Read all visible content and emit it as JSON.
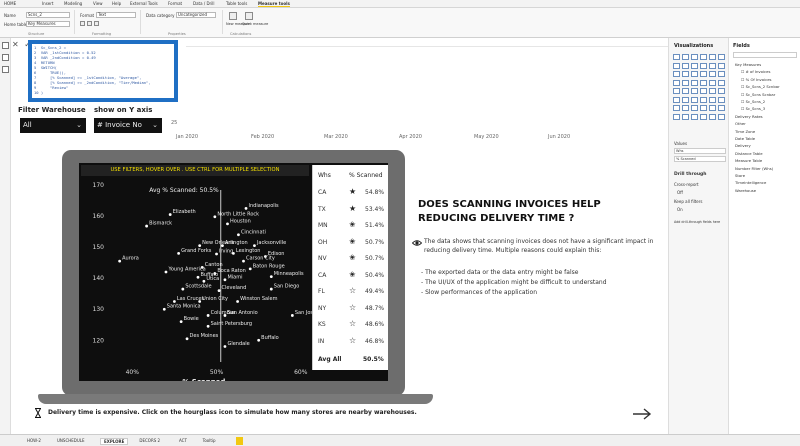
{
  "ribbon": {
    "tabs": [
      "HOME",
      "Insert",
      "Modeling",
      "View",
      "Help",
      "External Tools",
      "Format",
      "Data / Drill",
      "Table tools",
      "Measure tools"
    ],
    "active_tab": "Measure tools",
    "name_label": "Name",
    "name_value": "Scns_2",
    "home_table_label": "Home table",
    "home_table_value": "Key Measures",
    "format_label": "Format",
    "format_value": "Text",
    "data_category_label": "Data category",
    "data_category_value": "Uncategorized",
    "new_measure_label": "New measure",
    "quick_measure_label": "Quick measure",
    "groups": [
      "Structure",
      "Formatting",
      "Properties",
      "Calculations"
    ]
  },
  "code": {
    "lines": [
      "1  Sc_Scns_2 =",
      "2  VAR _1stCondition = 0.52",
      "3  VAR _2ndCondition = 0.49",
      "4  RETURN",
      "5  SWITCH(",
      "6      TRUE(),",
      "7      [% Scanned] >= _1stCondition, \"Average\",",
      "8      [% Scanned] >= _2ndCondition, \"Tier/Median\",",
      "9      \"Review\"",
      "10 )"
    ]
  },
  "line_chart": {
    "y_tick": "25",
    "x_ticks": [
      "Jan 2020",
      "Feb 2020",
      "Mar 2020",
      "Apr 2020",
      "May 2020",
      "Jun 2020"
    ]
  },
  "filters": {
    "filter_label": "Filter Warehouse",
    "filter_value": "All",
    "axis_label": "show on Y axis",
    "axis_value": "# Invoice No"
  },
  "scatter": {
    "banner": "USE FILTERS, HOVER OVER . USE CTRL FOR MULTIPLE SELECTION",
    "avg_label": "Avg % Scanned: 50.5%",
    "x_label": "% Scanned"
  },
  "chart_data": {
    "type": "scatter",
    "xlabel": "% Scanned",
    "x_ticks": [
      "40%",
      "50%",
      "60%"
    ],
    "y_ticks": [
      "170",
      "160",
      "150",
      "140",
      "130",
      "120"
    ],
    "xlim": [
      37,
      60.5
    ],
    "ylim": [
      113,
      171
    ],
    "avg_x": 50.5,
    "points": [
      {
        "label": "Indianapolis",
        "x": 53.5,
        "y": 162.5
      },
      {
        "label": "Elizabeth",
        "x": 44.5,
        "y": 160.5
      },
      {
        "label": "North Little Rock",
        "x": 49.8,
        "y": 159.8
      },
      {
        "label": "Bismarck",
        "x": 41.7,
        "y": 156.8
      },
      {
        "label": "Houston",
        "x": 51.3,
        "y": 157.5
      },
      {
        "label": "Cincinnati",
        "x": 52.6,
        "y": 154.0
      },
      {
        "label": "New Orleans",
        "x": 48.0,
        "y": 150.5
      },
      {
        "label": "Arlington",
        "x": 50.7,
        "y": 150.5
      },
      {
        "label": "Jacksonville",
        "x": 54.5,
        "y": 150.5
      },
      {
        "label": "Grand Forks",
        "x": 45.5,
        "y": 148.0
      },
      {
        "label": "Irving",
        "x": 50.0,
        "y": 147.8
      },
      {
        "label": "Lexington",
        "x": 52.0,
        "y": 148.0
      },
      {
        "label": "Edison",
        "x": 55.8,
        "y": 147.0
      },
      {
        "label": "Aurora",
        "x": 38.5,
        "y": 145.5
      },
      {
        "label": "Canton",
        "x": 48.3,
        "y": 143.5
      },
      {
        "label": "Carson City",
        "x": 53.2,
        "y": 145.5
      },
      {
        "label": "Young America",
        "x": 44.0,
        "y": 142.0
      },
      {
        "label": "Boca Raton",
        "x": 49.8,
        "y": 141.5
      },
      {
        "label": "Baton Rouge",
        "x": 54.0,
        "y": 143.0
      },
      {
        "label": "Minneapolis",
        "x": 56.5,
        "y": 140.5
      },
      {
        "label": "Buffalo",
        "x": 47.8,
        "y": 140.3
      },
      {
        "label": "Utica",
        "x": 48.5,
        "y": 139.0
      },
      {
        "label": "Miami",
        "x": 51.0,
        "y": 139.5
      },
      {
        "label": "Scottsdale",
        "x": 46.0,
        "y": 136.5
      },
      {
        "label": "Cleveland",
        "x": 50.3,
        "y": 136.0
      },
      {
        "label": "San Diego",
        "x": 56.5,
        "y": 136.5
      },
      {
        "label": "Las Cruces",
        "x": 45.0,
        "y": 132.5
      },
      {
        "label": "Union City",
        "x": 48.0,
        "y": 132.5
      },
      {
        "label": "Winston Salem",
        "x": 52.5,
        "y": 132.5
      },
      {
        "label": "Santa Monica",
        "x": 43.8,
        "y": 130.0
      },
      {
        "label": "Columbus",
        "x": 49.0,
        "y": 128.0
      },
      {
        "label": "San Antonio",
        "x": 51.0,
        "y": 128.0
      },
      {
        "label": "San Jose",
        "x": 59.0,
        "y": 128.0
      },
      {
        "label": "Bowie",
        "x": 45.8,
        "y": 126.0
      },
      {
        "label": "Saint Petersburg",
        "x": 49.0,
        "y": 124.5
      },
      {
        "label": "Des Moines",
        "x": 46.5,
        "y": 120.5
      },
      {
        "label": "Buffalo",
        "x": 55.0,
        "y": 120.0
      },
      {
        "label": "Glendale",
        "x": 51.0,
        "y": 118.0
      }
    ]
  },
  "state_table": {
    "col_state": "Whs",
    "col_pct": "% Scanned",
    "rows": [
      {
        "state": "CA",
        "pct": "54.8%",
        "star": "★"
      },
      {
        "state": "TX",
        "pct": "53.4%",
        "star": "★"
      },
      {
        "state": "MN",
        "pct": "51.4%",
        "star": "✬"
      },
      {
        "state": "OH",
        "pct": "50.7%",
        "star": "✬"
      },
      {
        "state": "NV",
        "pct": "50.7%",
        "star": "✬"
      },
      {
        "state": "CA",
        "pct": "50.4%",
        "star": "✬"
      },
      {
        "state": "FL",
        "pct": "49.4%",
        "star": "☆"
      },
      {
        "state": "NY",
        "pct": "48.7%",
        "star": "☆"
      },
      {
        "state": "KS",
        "pct": "48.6%",
        "star": "☆"
      },
      {
        "state": "IN",
        "pct": "46.8%",
        "star": "☆"
      }
    ],
    "footer_label": "Avg All",
    "footer_value": "50.5%"
  },
  "insight": {
    "title": "DOES SCANNING INVOICES HELP REDUCING DELIVERY TIME ?",
    "body": "The data shows that scanning invoices does not have a significant impact in reducing delivery time. Multiple reasons could explain this:",
    "bullets": [
      "- The exported data or the data entry might be false",
      "- The UI/UX of the application might be difficult to understand",
      "- Slow performances of the application"
    ]
  },
  "bottom_note": "Delivery time is expensive. Click on the hourglass icon to simulate how many stores are nearby warehouses.",
  "visualizations": {
    "title": "Visualizations",
    "values_label": "Values",
    "values_fields": [
      "Whs",
      "% Scanned"
    ],
    "drill_title": "Drill through",
    "cross_report": "Cross-report",
    "off_label": "Off",
    "keep_filters": "Keep all filters",
    "on_label": "On",
    "add_drill": "Add drill-through fields here"
  },
  "fields": {
    "title": "Fields",
    "items": [
      "Key Measures",
      "# of Invoices",
      "% Of Invoices",
      "Sc_Scns_2 Scnbar",
      "Sc_Scns Scnbar",
      "Sc_Scns_2",
      "Sc_Scns_3",
      "Delivery Rates",
      "Other",
      "Time Zone",
      "Date Table",
      "Delivery",
      "Distance Table",
      "Measure Table",
      "Number Filter (Whs)",
      "Store",
      "Timeintelligence",
      "Warehouse"
    ]
  },
  "page_tabs": [
    "HOW-2",
    "UNSCHEDULE",
    "EXPLORE",
    "DECORS 2",
    "ACT",
    "Tooltip"
  ],
  "active_page": "EXPLORE",
  "colors": {
    "accent": "#f2c811",
    "code_border": "#1f6fc4",
    "banner_text": "#f5e000",
    "dark": "#0e0e0e"
  }
}
